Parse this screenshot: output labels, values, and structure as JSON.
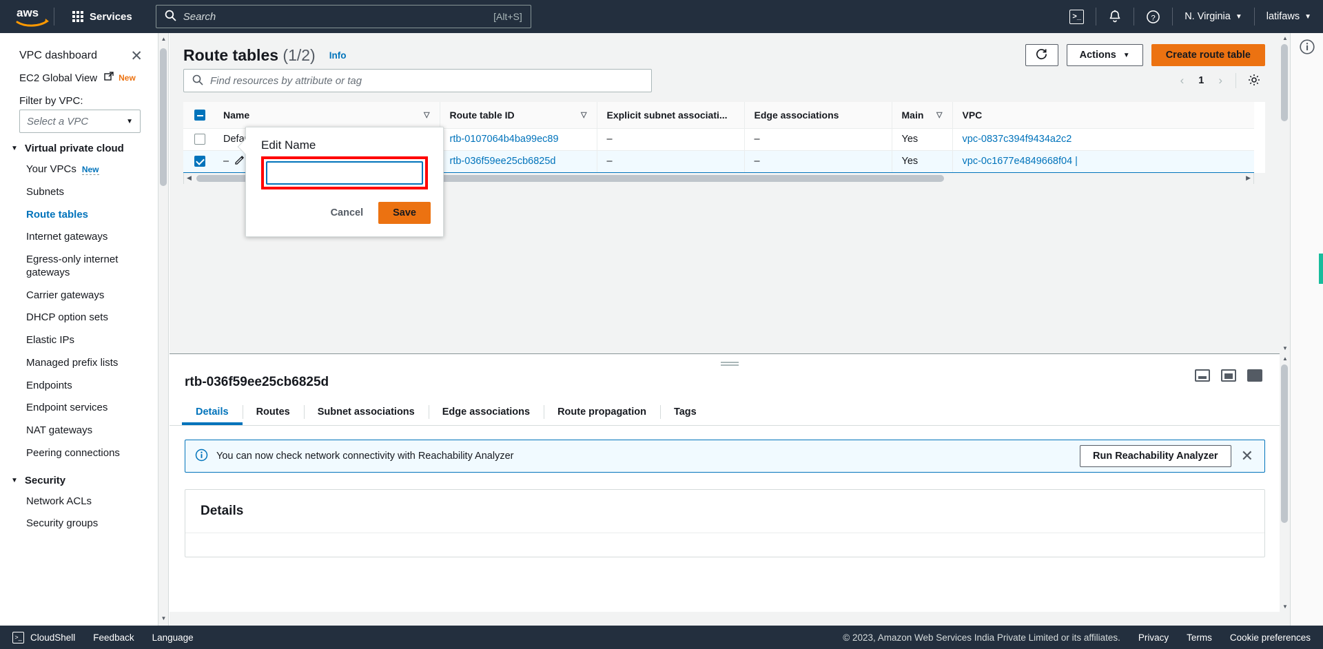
{
  "topnav": {
    "logo_alt": "aws",
    "services_label": "Services",
    "search": {
      "placeholder": "Search",
      "shortcut": "[Alt+S]",
      "icon": "search-icon"
    },
    "cloudshell_icon": "cloudshell-icon",
    "notifications_icon": "bell-icon",
    "help_icon": "question-circle-icon",
    "region": "N. Virginia",
    "account": "latifaws",
    "caret": "▼"
  },
  "sidebar": {
    "title": "VPC dashboard",
    "close_icon": "close-icon",
    "global_view": {
      "label": "EC2 Global View",
      "badge": "New",
      "external_icon": "external-link-icon"
    },
    "filter_label": "Filter by VPC:",
    "vpc_select": {
      "value": "Select a VPC",
      "caret": "▼"
    },
    "groups": [
      {
        "label": "Virtual private cloud",
        "tri": "▼",
        "items": [
          {
            "label": "Your VPCs",
            "badge": "New",
            "active": false
          },
          {
            "label": "Subnets",
            "active": false
          },
          {
            "label": "Route tables",
            "active": true
          },
          {
            "label": "Internet gateways",
            "active": false
          },
          {
            "label": "Egress-only internet gateways",
            "active": false
          },
          {
            "label": "Carrier gateways",
            "active": false
          },
          {
            "label": "DHCP option sets",
            "active": false
          },
          {
            "label": "Elastic IPs",
            "active": false
          },
          {
            "label": "Managed prefix lists",
            "active": false
          },
          {
            "label": "Endpoints",
            "active": false
          },
          {
            "label": "Endpoint services",
            "active": false
          },
          {
            "label": "NAT gateways",
            "active": false
          },
          {
            "label": "Peering connections",
            "active": false
          }
        ]
      },
      {
        "label": "Security",
        "tri": "▼",
        "items": [
          {
            "label": "Network ACLs",
            "active": false
          },
          {
            "label": "Security groups",
            "active": false
          }
        ]
      }
    ]
  },
  "page": {
    "title": "Route tables",
    "count": "(1/2)",
    "info_label": "Info",
    "refresh_icon": "refresh-icon",
    "actions_label": "Actions",
    "actions_caret": "▼",
    "create_label": "Create route table",
    "search": {
      "placeholder": "Find resources by attribute or tag",
      "icon": "search-icon"
    },
    "pagination": {
      "prev": "‹",
      "page": "1",
      "next": "›"
    },
    "settings_icon": "gear-icon"
  },
  "table": {
    "columns": [
      {
        "label": "Name",
        "sortable": true
      },
      {
        "label": "Route table ID",
        "sortable": true
      },
      {
        "label": "Explicit subnet associati...",
        "sortable": false
      },
      {
        "label": "Edge associations",
        "sortable": false
      },
      {
        "label": "Main",
        "sortable": true
      },
      {
        "label": "VPC",
        "sortable": false
      }
    ],
    "sort_icon": "▽",
    "rows": [
      {
        "selected": false,
        "name": "DefaultRT",
        "route_table_id": "rtb-0107064b4ba99ec89",
        "explicit_subnet": "–",
        "edge_associations": "–",
        "main": "Yes",
        "vpc": "vpc-0837c394f9434a2c2"
      },
      {
        "selected": true,
        "name": "–",
        "route_table_id": "rtb-036f59ee25cb6825d",
        "explicit_subnet": "–",
        "edge_associations": "–",
        "main": "Yes",
        "vpc": "vpc-0c1677e4849668f04 |"
      }
    ]
  },
  "popover": {
    "title": "Edit Name",
    "input_value": "",
    "cancel_label": "Cancel",
    "save_label": "Save"
  },
  "split_panel": {
    "resource_id": "rtb-036f59ee25cb6825d",
    "grip_icon": "drag-handle-icon",
    "view_icons": [
      "panel-bottom-icon",
      "panel-split-icon",
      "panel-full-icon"
    ],
    "tabs": [
      {
        "label": "Details",
        "active": true
      },
      {
        "label": "Routes",
        "active": false
      },
      {
        "label": "Subnet associations",
        "active": false
      },
      {
        "label": "Edge associations",
        "active": false
      },
      {
        "label": "Route propagation",
        "active": false
      },
      {
        "label": "Tags",
        "active": false
      }
    ],
    "banner": {
      "icon": "info-circle-icon",
      "text": "You can now check network connectivity with Reachability Analyzer",
      "button": "Run Reachability Analyzer",
      "close_icon": "close-icon"
    },
    "details_heading": "Details"
  },
  "rail": {
    "info_icon": "info-circle-icon"
  },
  "footer": {
    "cloudshell": "CloudShell",
    "feedback": "Feedback",
    "language": "Language",
    "copyright": "© 2023, Amazon Web Services India Private Limited or its affiliates.",
    "privacy": "Privacy",
    "terms": "Terms",
    "cookies": "Cookie preferences"
  },
  "colors": {
    "nav_bg": "#232f3e",
    "accent_orange": "#ec7211",
    "link_blue": "#0073bb",
    "highlight_red": "#ff0000",
    "panel_bg": "#f2f3f3"
  }
}
